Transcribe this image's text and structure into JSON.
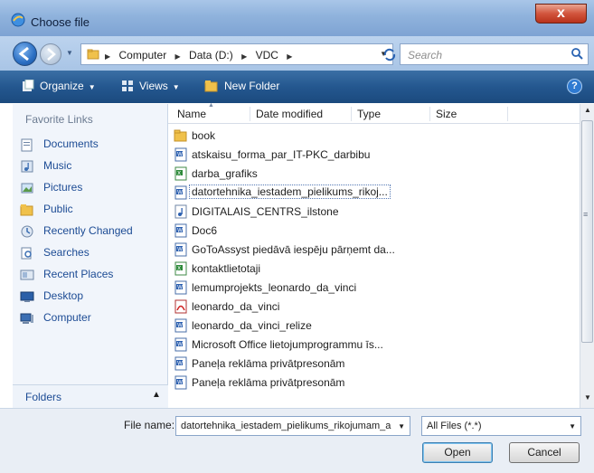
{
  "window": {
    "title": "Choose file",
    "close_label": "x"
  },
  "address": {
    "crumbs": [
      "Computer",
      "Data (D:)",
      "VDC"
    ],
    "search_placeholder": "Search"
  },
  "toolbar": {
    "organize": "Organize",
    "views": "Views",
    "new_folder": "New Folder",
    "help": "?"
  },
  "favorites": {
    "header": "Favorite Links",
    "items": [
      {
        "label": "Documents",
        "icon": "documents-icon"
      },
      {
        "label": "Music",
        "icon": "music-icon"
      },
      {
        "label": "Pictures",
        "icon": "pictures-icon"
      },
      {
        "label": "Public",
        "icon": "public-folder-icon"
      },
      {
        "label": "Recently Changed",
        "icon": "recently-changed-icon"
      },
      {
        "label": "Searches",
        "icon": "searches-icon"
      },
      {
        "label": "Recent Places",
        "icon": "recent-places-icon"
      },
      {
        "label": "Desktop",
        "icon": "desktop-icon"
      },
      {
        "label": "Computer",
        "icon": "computer-icon"
      }
    ],
    "folders_label": "Folders"
  },
  "columns": [
    "Name",
    "Date modified",
    "Type",
    "Size"
  ],
  "files": [
    {
      "name": "book",
      "icon": "folder-icon"
    },
    {
      "name": "atskaisu_forma_par_IT-PKC_darbibu",
      "icon": "word-doc-icon"
    },
    {
      "name": "darba_grafiks",
      "icon": "excel-icon"
    },
    {
      "name": "datortehnika_iestadem_pielikums_rikoj...",
      "icon": "word-doc-icon",
      "selected": true
    },
    {
      "name": "DIGITALAIS_CENTRS_ilstone",
      "icon": "audio-file-icon"
    },
    {
      "name": "Doc6",
      "icon": "word-doc-icon"
    },
    {
      "name": "GoToAssyst piedāvā iespēju pārņemt da...",
      "icon": "word-doc-icon"
    },
    {
      "name": "kontaktlietotaji",
      "icon": "excel-icon"
    },
    {
      "name": "lemumprojekts_leonardo_da_vinci",
      "icon": "word-doc-icon"
    },
    {
      "name": "leonardo_da_vinci",
      "icon": "pdf-icon"
    },
    {
      "name": "leonardo_da_vinci_relize",
      "icon": "word-doc-icon"
    },
    {
      "name": "Microsoft Office lietojumprogrammu īs...",
      "icon": "word-doc-icon"
    },
    {
      "name": "Paneļa reklāma privātpresonām",
      "icon": "word-doc-icon"
    },
    {
      "name": "Paneļa reklāma privātpresonām",
      "icon": "word-doc-icon"
    }
  ],
  "bottom": {
    "file_name_label": "File name:",
    "file_name_value": "datortehnika_iestadem_pielikums_rikojumam_a",
    "filter_value": "All Files (*.*)",
    "open_label": "Open",
    "cancel_label": "Cancel"
  }
}
